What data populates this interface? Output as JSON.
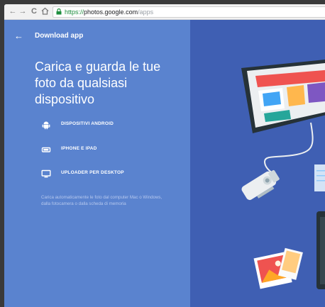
{
  "browser": {
    "url_scheme": "https://",
    "url_host": "photos.google.com",
    "url_path": "/apps"
  },
  "header": {
    "back_icon": "arrow-left-icon",
    "title": "Download app"
  },
  "headline": "Carica e guarda le tue foto da qualsiasi dispositivo",
  "options": [
    {
      "icon": "android-icon",
      "label": "DISPOSITIVI ANDROID"
    },
    {
      "icon": "iphone-icon",
      "label": "IPHONE E IPAD"
    },
    {
      "icon": "desktop-icon",
      "label": "UPLOADER PER DESKTOP"
    }
  ],
  "description": "Carica automaticamente le foto dal computer Mac o Windows, dalla fotocamera o dalla scheda di memoria",
  "colors": {
    "left_panel": "#5a83cf",
    "right_panel": "#3f5fb3",
    "secure_green": "#1e8e3e"
  }
}
